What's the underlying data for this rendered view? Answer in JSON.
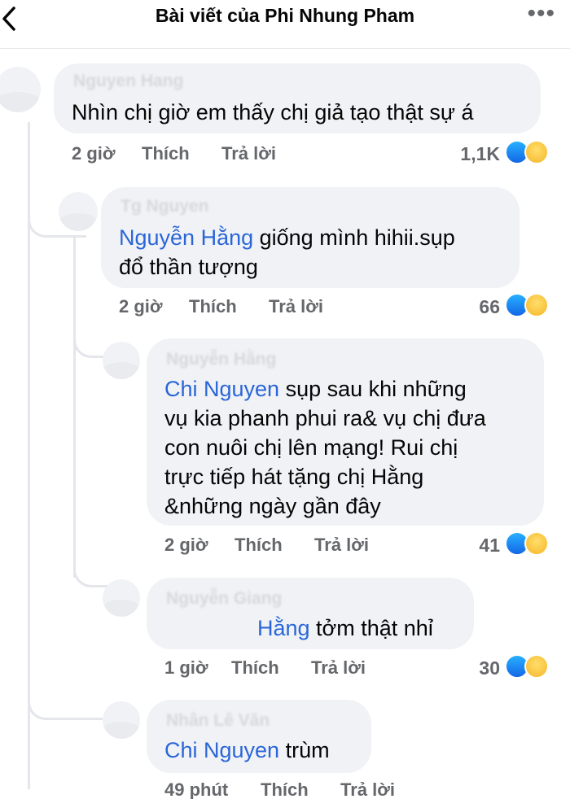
{
  "header": {
    "title": "Bài viết của Phi Nhung Pham",
    "more_label": "•••"
  },
  "comments": [
    {
      "author": "Nguyen Hang",
      "mention": "",
      "text": "Nhìn chị giờ em thấy chị giả tạo thật sự á",
      "time": "2 giờ",
      "like_label": "Thích",
      "reply_label": "Trả lời",
      "count": "1,1K"
    },
    {
      "author": "Tg Nguyen",
      "mention": "Nguyễn Hằng",
      "text": " giống mình hihii.sụp\nđổ thần tượng",
      "time": "2 giờ",
      "like_label": "Thích",
      "reply_label": "Trả lời",
      "count": "66"
    },
    {
      "author": "Nguyễn Hằng",
      "mention": "Chi Nguyen",
      "text": " sụp sau khi những\nvụ kia phanh phui ra& vụ chị đưa\ncon nuôi chị lên mạng! Rui chị\ntrực tiếp hát tặng chị Hằng\n&những ngày gần đây",
      "time": "2 giờ",
      "like_label": "Thích",
      "reply_label": "Trả lời",
      "count": "41"
    },
    {
      "author": "Nguyễn Giang",
      "mention": "Hằng",
      "text": " tởm thật nhỉ",
      "time": "1 giờ",
      "like_label": "Thích",
      "reply_label": "Trả lời",
      "count": "30"
    },
    {
      "author": "Nhân Lê Văn",
      "mention": "Chi Nguyen",
      "text": " trùm",
      "time": "49 phút",
      "like_label": "Thích",
      "reply_label": "Trả lời",
      "count": ""
    }
  ],
  "colors": {
    "mention": "#2a66d8",
    "bubble": "#f0f2f5",
    "meta": "#65676b",
    "like": "#1467e6"
  },
  "icons": {
    "back": "chevron-left-icon",
    "more": "more-dots-icon",
    "like": "like-reaction-icon",
    "haha": "haha-reaction-icon"
  }
}
